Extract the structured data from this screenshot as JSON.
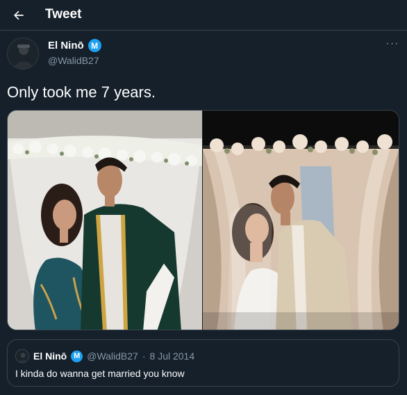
{
  "header": {
    "title": "Tweet",
    "back_icon": "arrow-left-icon"
  },
  "tweet": {
    "author_name": "El Ninō",
    "verified_badge_letter": "M",
    "handle": "@WalidB27",
    "more_icon": "more-horizontal-icon",
    "more_label": "···",
    "text": "Only took me 7 years.",
    "media": [
      {
        "icon": "photo-icon"
      },
      {
        "icon": "photo-icon"
      }
    ]
  },
  "quote": {
    "author_name": "El Ninō",
    "verified_badge_letter": "M",
    "handle": "@WalidB27",
    "separator": "·",
    "date": "8 Jul 2014",
    "text": "I kinda do wanna get married you know"
  },
  "colors": {
    "background": "#15202b",
    "border": "#38444d",
    "secondary_text": "#8899a6",
    "verified": "#1da1f2"
  }
}
